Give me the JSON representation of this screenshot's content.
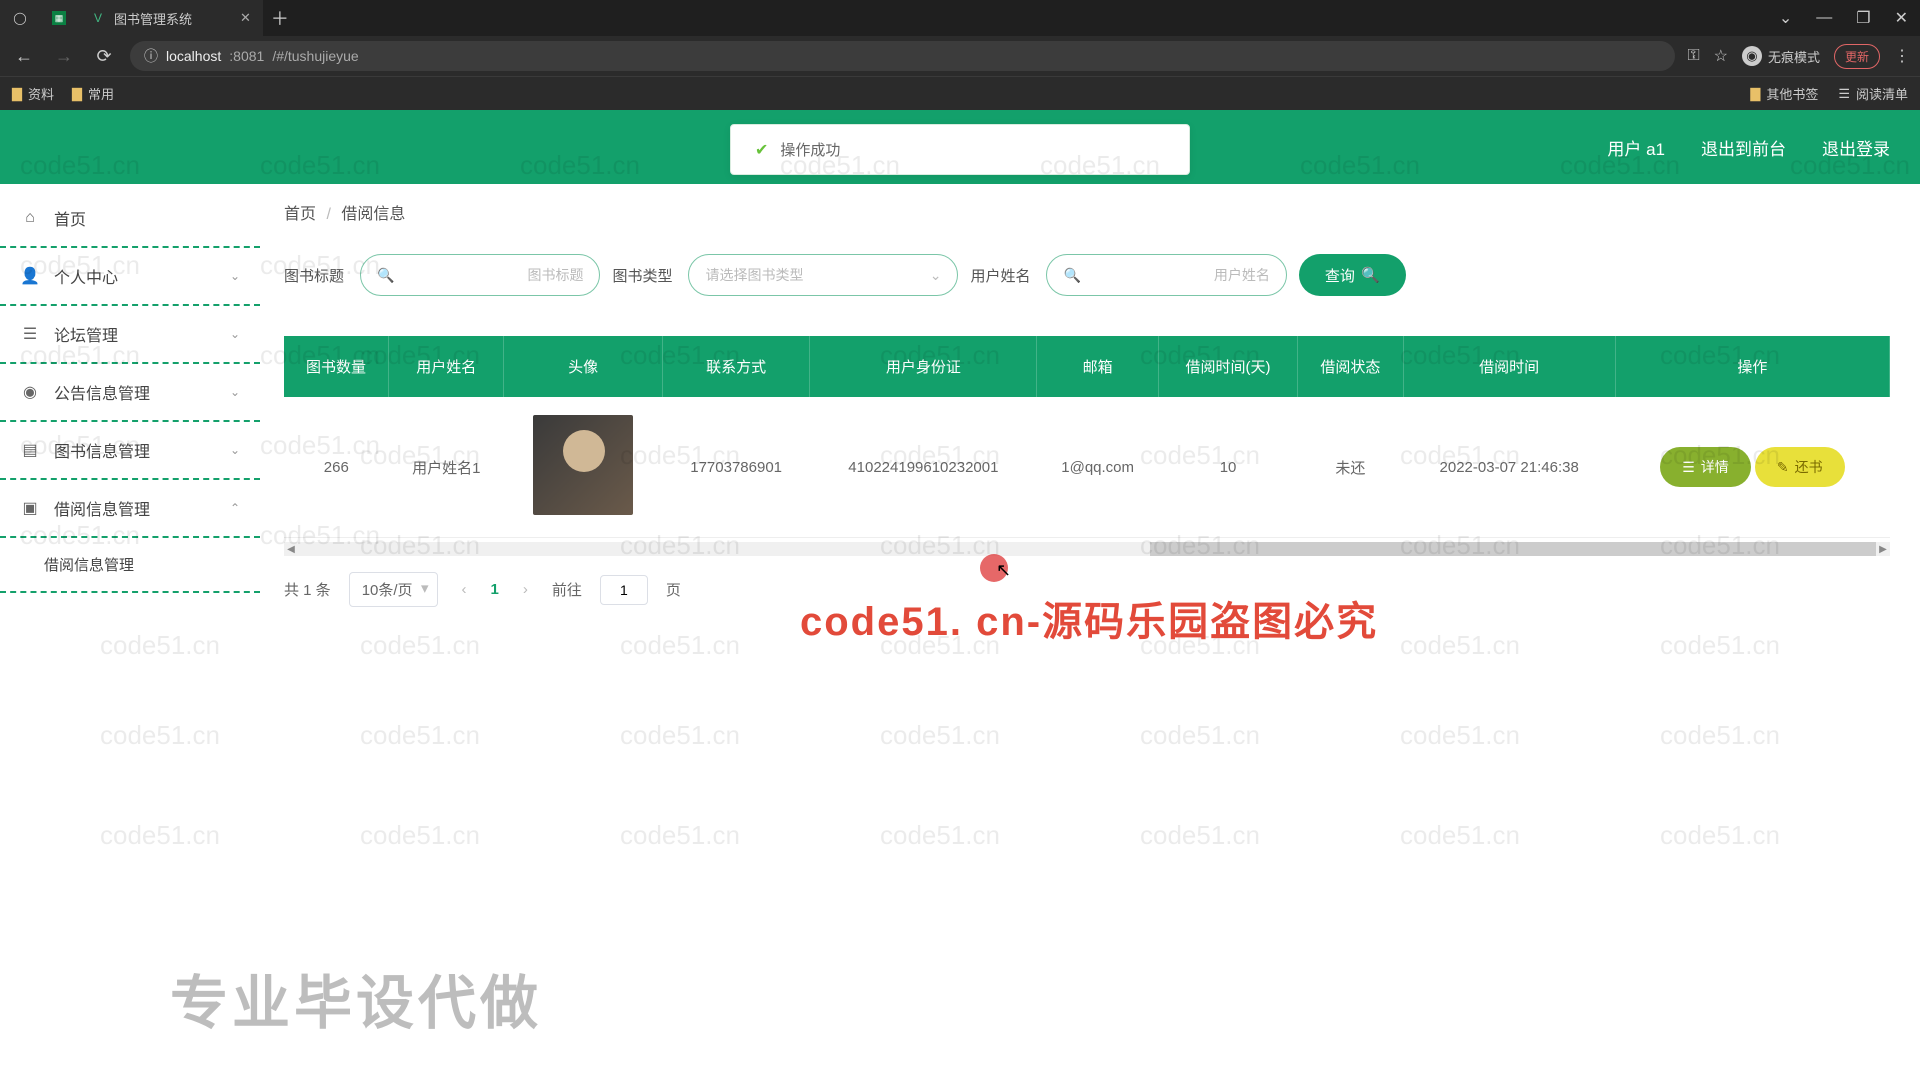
{
  "browser": {
    "tab_title": "图书管理系统",
    "url_host": "localhost",
    "url_port": ":8081",
    "url_path": "/#/tushujieyue",
    "bookmarks": {
      "b1": "资料",
      "b2": "常用",
      "b3": "其他书签",
      "b4": "阅读清单"
    },
    "incognito": "无痕模式",
    "update": "更新"
  },
  "header": {
    "toast": "操作成功",
    "user_label": "用户 a1",
    "exit_front": "退出到前台",
    "logout": "退出登录"
  },
  "sidebar": {
    "home": "首页",
    "personal": "个人中心",
    "forum": "论坛管理",
    "notice": "公告信息管理",
    "book": "图书信息管理",
    "borrow": "借阅信息管理",
    "borrow_sub": "借阅信息管理"
  },
  "breadcrumb": {
    "home": "首页",
    "current": "借阅信息"
  },
  "search": {
    "label_title": "图书标题",
    "ph_title": "图书标题",
    "label_type": "图书类型",
    "ph_type": "请选择图书类型",
    "label_user": "用户姓名",
    "ph_user": "用户姓名",
    "btn": "查询"
  },
  "table": {
    "headers": {
      "qty": "图书数量",
      "uname": "用户姓名",
      "avatar": "头像",
      "contact": "联系方式",
      "idcard": "用户身份证",
      "email": "邮箱",
      "days": "借阅时间(天)",
      "status": "借阅状态",
      "btime": "借阅时间",
      "ops": "操作"
    },
    "row": {
      "qty": "266",
      "uname": "用户姓名1",
      "contact": "17703786901",
      "idcard": "410224199610232001",
      "email": "1@qq.com",
      "days": "10",
      "status": "未还",
      "btime": "2022-03-07 21:46:38"
    },
    "btn_detail": "详情",
    "btn_return": "还书"
  },
  "pager": {
    "total": "共 1 条",
    "per_page": "10条/页",
    "current": "1",
    "goto_prefix": "前往",
    "goto_value": "1",
    "goto_suffix": "页"
  },
  "overlay": {
    "red": "code51. cn-源码乐园盗图必究",
    "watermark": "code51.cn",
    "footer": "专业毕设代做"
  }
}
